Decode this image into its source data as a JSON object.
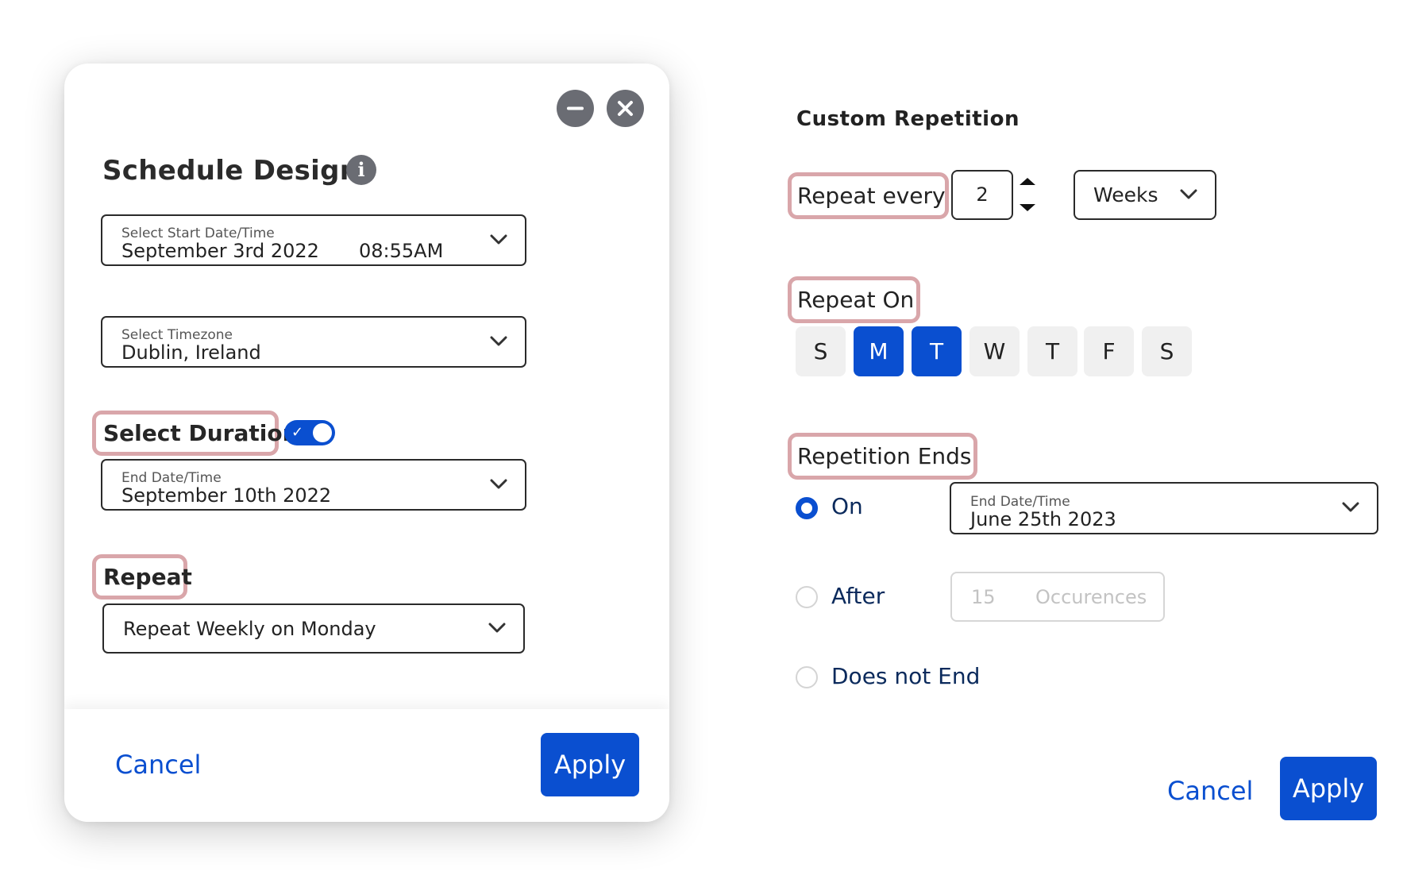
{
  "schedule_modal": {
    "title": "Schedule Design",
    "info_icon": "info-icon",
    "window_controls": {
      "minimize_icon": "minus-icon",
      "close_icon": "close-icon"
    },
    "start_field": {
      "label": "Select Start Date/Time",
      "date_value": "September 3rd 2022",
      "time_value": "08:55AM"
    },
    "timezone_field": {
      "label": "Select Timezone",
      "value": "Dublin, Ireland"
    },
    "duration": {
      "label": "Select Duration",
      "toggle_on": true,
      "end_field": {
        "label": "End Date/Time",
        "value": "September 10th 2022"
      }
    },
    "repeat": {
      "label": "Repeat",
      "value": "Repeat Weekly on Monday"
    },
    "footer": {
      "cancel_label": "Cancel",
      "apply_label": "Apply"
    }
  },
  "custom_repetition": {
    "title": "Custom Repetition",
    "repeat_every": {
      "label": "Repeat every",
      "value": "2",
      "unit": "Weeks"
    },
    "repeat_on": {
      "label": "Repeat On",
      "days": [
        {
          "label": "S",
          "selected": false
        },
        {
          "label": "M",
          "selected": true
        },
        {
          "label": "T",
          "selected": true
        },
        {
          "label": "W",
          "selected": false
        },
        {
          "label": "T",
          "selected": false
        },
        {
          "label": "F",
          "selected": false
        },
        {
          "label": "S",
          "selected": false
        }
      ]
    },
    "repetition_ends": {
      "label": "Repetition Ends",
      "options": {
        "on": {
          "label": "On",
          "selected": true
        },
        "after": {
          "label": "After",
          "selected": false
        },
        "never": {
          "label": "Does not End",
          "selected": false
        }
      },
      "end_field": {
        "label": "End Date/Time",
        "value": "June 25th 2023"
      },
      "occurrences": {
        "placeholder_value": "15",
        "placeholder_unit": "Occurences"
      }
    },
    "footer": {
      "cancel_label": "Cancel",
      "apply_label": "Apply"
    }
  },
  "colors": {
    "accent": "#0a4fd0",
    "highlight_outline": "#d9a6aa",
    "icon_gray": "#6a6c73",
    "day_inactive_bg": "#f0f0f0"
  }
}
